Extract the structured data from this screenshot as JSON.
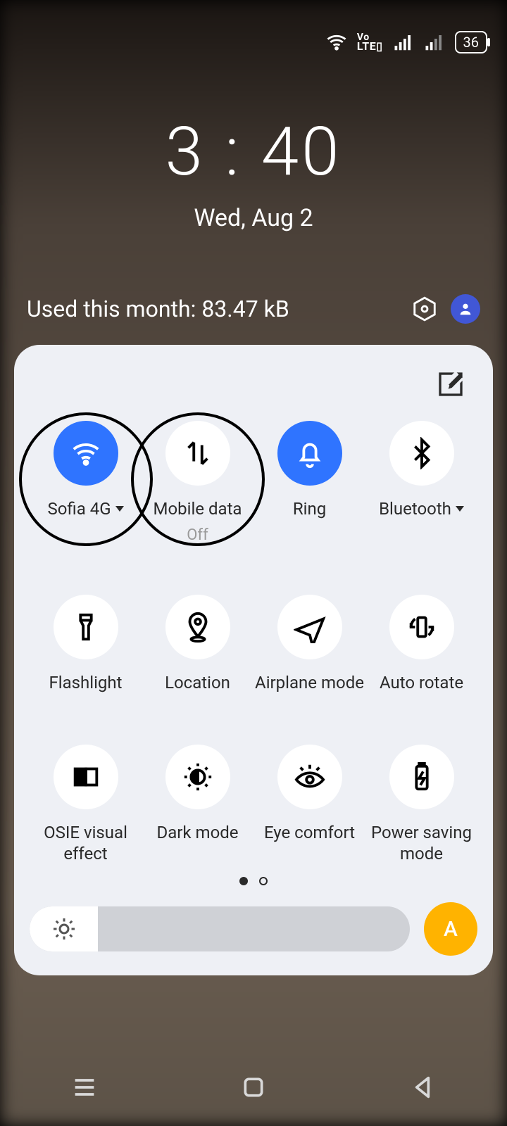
{
  "status": {
    "battery": "36"
  },
  "clock": {
    "time": "3 : 40",
    "date": "Wed, Aug 2"
  },
  "usage": {
    "text": "Used this month: 83.47 kB"
  },
  "tiles": {
    "wifi": {
      "label": "Sofia 4G"
    },
    "data": {
      "label": "Mobile data",
      "sub": "Off"
    },
    "ring": {
      "label": "Ring"
    },
    "bt": {
      "label": "Bluetooth"
    },
    "flash": {
      "label": "Flashlight"
    },
    "location": {
      "label": "Location"
    },
    "airplane": {
      "label": "Airplane mode"
    },
    "rotate": {
      "label": "Auto rotate"
    },
    "osie": {
      "label": "OSIE visual effect"
    },
    "dark": {
      "label": "Dark mode"
    },
    "eye": {
      "label": "Eye comfort"
    },
    "power": {
      "label": "Power saving mode"
    }
  },
  "brightness": {
    "auto": "A"
  }
}
